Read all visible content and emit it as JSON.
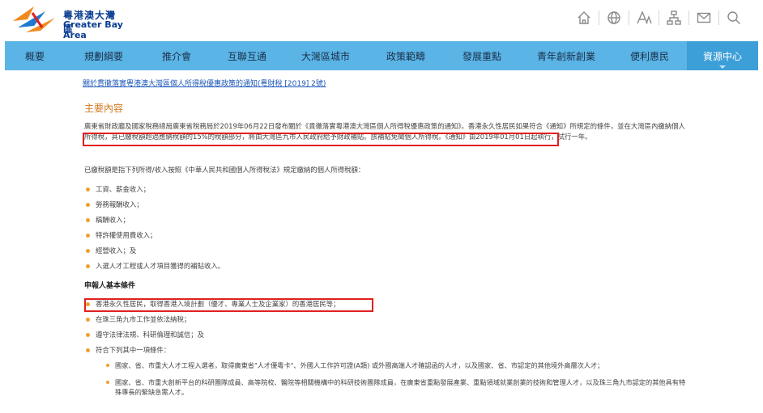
{
  "header": {
    "logo_cn": "粵港澳大灣區",
    "logo_en": "Greater Bay Area",
    "brand_colors": {
      "orange": "#f08a1c",
      "blue": "#1d7ad0",
      "red": "#e02020"
    },
    "tools": [
      "home-icon",
      "globe-icon",
      "font-size-icon",
      "sitemap-icon",
      "mail-icon",
      "search-icon"
    ]
  },
  "nav": {
    "items": [
      {
        "label": "概要"
      },
      {
        "label": "規劃綱要"
      },
      {
        "label": "推介會"
      },
      {
        "label": "互聯互通"
      },
      {
        "label": "大灣區城市"
      },
      {
        "label": "政策範疇"
      },
      {
        "label": "發展重點"
      },
      {
        "label": "青年創新創業"
      },
      {
        "label": "便利惠民"
      },
      {
        "label": "資源中心"
      }
    ],
    "active": "資源中心"
  },
  "content": {
    "link": "關於貫徹落實粵港澳大灣區個人所得稅優惠政策的通知(粵財稅 [2019] 2號)",
    "section_title": "主要內容",
    "para1": "廣東省財政廳及國家稅務總局廣東省稅務局於2019年06月22日發布關於《貫徹落實粵港澳大灣區個人所得稅優惠政策的通知》。香港永久性居民如果符合《通知》所規定的條件，並在大灣區內繳納個人所得稅，其已繳稅額超過應納稅額的15%的稅額部分，將由大灣區九市人民政府給予財政補貼。該補貼免徵個人所得稅。《通知》由2019年01月01日起執行，試行一年。",
    "para2": "已繳稅額是指下列所得/收入按照《中華人民共和國個人所得稅法》規定繳納的個人所得稅額：",
    "income_items": [
      "工資、薪金收入；",
      "勞務報酬收入；",
      "稿酬收入；",
      "特許權使用費收入；",
      "經營收入；及",
      "入選人才工程或人才項目獲得的補貼收入。"
    ],
    "subhead": "申報人基本條件",
    "conditions": [
      "香港永久性居民，取得香港入境計劃（優才、專業人士及企業家）的香港居民等；",
      "在珠三角九市工作並依法納稅；",
      "遵守法律法規、科研倫理和誠信；及",
      "符合下列其中一項條件："
    ],
    "sub_conditions": [
      "國家、省、市重大人才工程入選者，取得廣東省\"人才優粵卡\"、外國人工作許可證(A類) 或外國高端人才確認函的人才，以及國家、省、市認定的其他境外高層次人才；",
      "國家、省、市重大創新平台的科研團隊成員、高等院校、醫院等相關機構中的科研技術團隊成員，在廣東省重點發展產業、重點領域就業創業的技術和管理人才，以及珠三角九市認定的其他具有特殊專長的緊缺急需人才。"
    ]
  }
}
